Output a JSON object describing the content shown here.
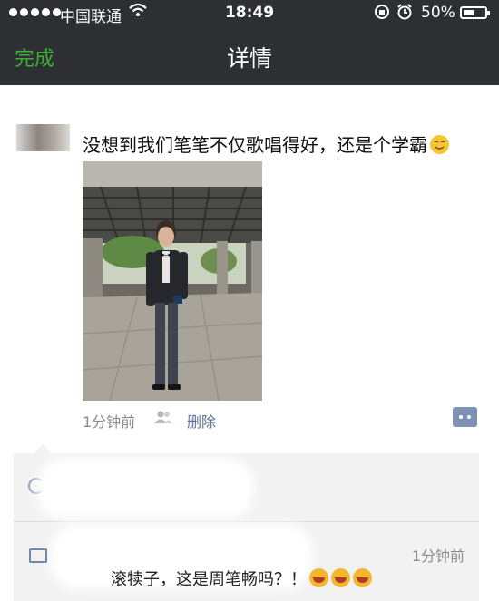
{
  "status_bar": {
    "carrier": "中国联通",
    "time": "18:49",
    "battery_percent": "50%",
    "battery_level": 0.5
  },
  "nav": {
    "done_label": "完成",
    "title": "详情"
  },
  "post": {
    "text": "没想到我们笔笔不仅歌唱得好，还是个学霸",
    "emoji": "smile",
    "time": "1分钟前",
    "delete_label": "删除"
  },
  "comment": {
    "time": "1分钟前",
    "text": "滚犊子，这是周笔畅吗？！",
    "emoji_count": 3,
    "emoji": "laughing-crying"
  },
  "colors": {
    "header_bg": "#2e2f33",
    "done_green": "#3cb034",
    "link_blue": "#5a6b93",
    "comment_bg": "#f2f2f2"
  }
}
